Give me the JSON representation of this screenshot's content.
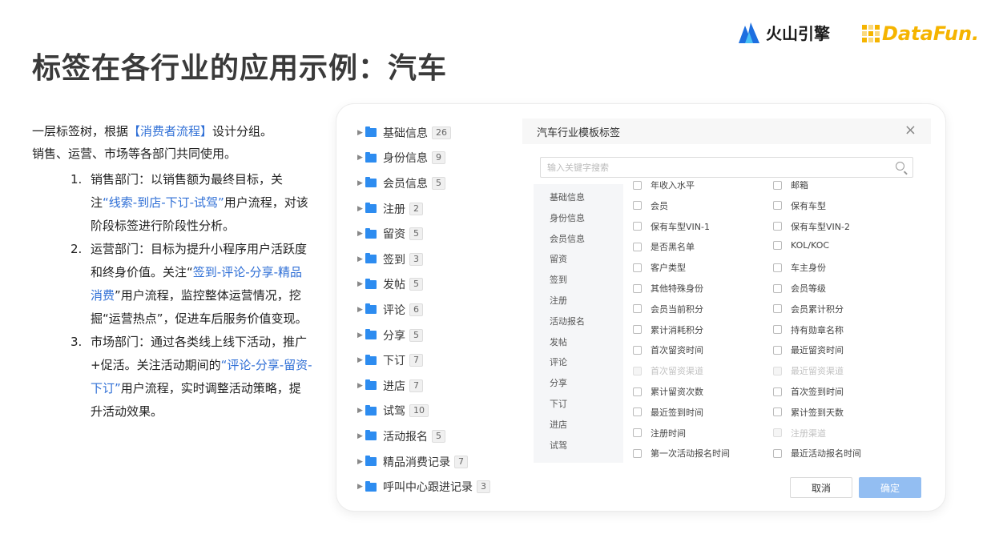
{
  "title": "标签在各行业的应用示例：汽车",
  "logos": {
    "volc": "火山引擎",
    "datafun": "DataFun."
  },
  "intro": {
    "line1_pre": "一层标签树，根据",
    "line1_hl": "【消费者流程】",
    "line1_post": "设计分组。",
    "line2": "销售、运营、市场等各部门共同使用。"
  },
  "departments": [
    {
      "num": "1.",
      "pre": "销售部门：以销售额为最终目标，关注",
      "hl": "“线索-到店-下订-试驾”",
      "post": "用户流程，对该阶段标签进行阶段性分析。"
    },
    {
      "num": "2.",
      "pre": "运营部门：目标为提升小程序用户活跃度和终身价值。关注“",
      "hl": "签到-评论-分享-精品消费",
      "post": "”用户流程，监控整体运营情况，挖掘“运营热点”，促进车后服务价值变现。"
    },
    {
      "num": "3.",
      "pre": "市场部门：通过各类线上线下活动，推广+促活。关注活动期间的",
      "hl": "“评论-分享-留资-下订”",
      "post": "用户流程，实时调整活动策略，提升活动效果。"
    }
  ],
  "tree": [
    {
      "label": "基础信息",
      "count": "26"
    },
    {
      "label": "身份信息",
      "count": "9"
    },
    {
      "label": "会员信息",
      "count": "5"
    },
    {
      "label": "注册",
      "count": "2"
    },
    {
      "label": "留资",
      "count": "5"
    },
    {
      "label": "签到",
      "count": "3"
    },
    {
      "label": "发帖",
      "count": "5"
    },
    {
      "label": "评论",
      "count": "6"
    },
    {
      "label": "分享",
      "count": "5"
    },
    {
      "label": "下订",
      "count": "7"
    },
    {
      "label": "进店",
      "count": "7"
    },
    {
      "label": "试驾",
      "count": "10"
    },
    {
      "label": "活动报名",
      "count": "5"
    },
    {
      "label": "精品消费记录",
      "count": "7"
    },
    {
      "label": "呼叫中心跟进记录",
      "count": "3"
    }
  ],
  "dialog": {
    "title": "汽车行业模板标签",
    "close": "×",
    "search_placeholder": "输入关键字搜索",
    "categories": [
      "基础信息",
      "身份信息",
      "会员信息",
      "留资",
      "签到",
      "注册",
      "活动报名",
      "发帖",
      "评论",
      "分享",
      "下订",
      "进店",
      "试驾"
    ],
    "left_options": [
      {
        "label": "年收入水平",
        "disabled": false
      },
      {
        "label": "会员",
        "disabled": false
      },
      {
        "label": "保有车型VIN-1",
        "disabled": false
      },
      {
        "label": "是否黑名单",
        "disabled": false
      },
      {
        "label": "客户类型",
        "disabled": false
      },
      {
        "label": "其他特殊身份",
        "disabled": false
      },
      {
        "label": "会员当前积分",
        "disabled": false
      },
      {
        "label": "累计消耗积分",
        "disabled": false
      },
      {
        "label": "首次留资时间",
        "disabled": false
      },
      {
        "label": "首次留资渠道",
        "disabled": true
      },
      {
        "label": "累计留资次数",
        "disabled": false
      },
      {
        "label": "最近签到时间",
        "disabled": false
      },
      {
        "label": "注册时间",
        "disabled": false
      },
      {
        "label": "第一次活动报名时间",
        "disabled": false
      }
    ],
    "right_options": [
      {
        "label": "邮箱",
        "disabled": false
      },
      {
        "label": "保有车型",
        "disabled": false
      },
      {
        "label": "保有车型VIN-2",
        "disabled": false
      },
      {
        "label": "KOL/KOC",
        "disabled": false
      },
      {
        "label": "车主身份",
        "disabled": false
      },
      {
        "label": "会员等级",
        "disabled": false
      },
      {
        "label": "会员累计积分",
        "disabled": false
      },
      {
        "label": "持有勋章名称",
        "disabled": false
      },
      {
        "label": "最近留资时间",
        "disabled": false
      },
      {
        "label": "最近留资渠道",
        "disabled": true
      },
      {
        "label": "首次签到时间",
        "disabled": false
      },
      {
        "label": "累计签到天数",
        "disabled": false
      },
      {
        "label": "注册渠道",
        "disabled": true
      },
      {
        "label": "最近活动报名时间",
        "disabled": false
      }
    ],
    "cancel_label": "取消",
    "ok_label": "确定"
  },
  "colors": {
    "highlight": "#2f6fd6",
    "folder": "#2d8cf0",
    "primary_button": "#93bef2",
    "brand_datafun": "#f5b400"
  }
}
